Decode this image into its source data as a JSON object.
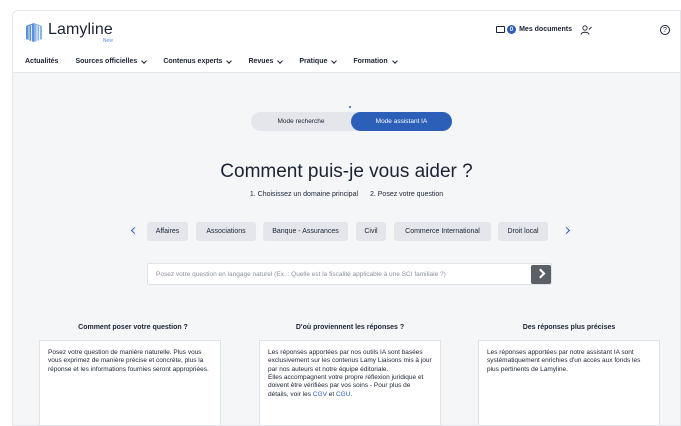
{
  "brand": {
    "name": "Lamyline",
    "sub": "New"
  },
  "header": {
    "docs_count": "0",
    "docs_label": "Mes documents",
    "help": "?"
  },
  "nav": [
    "Actualités",
    "Sources officielles",
    "Contenus experts",
    "Revues",
    "Pratique",
    "Formation"
  ],
  "mode": {
    "search": "Mode recherche",
    "assistant": "Mode assistant IA",
    "active": "assistant"
  },
  "main": {
    "title": "Comment puis-je vous aider ?",
    "step1": "1. Choisissez un domaine principal",
    "step2": "2. Posez votre question"
  },
  "domains": [
    "Affaires",
    "Associations",
    "Banque - Assurances",
    "Civil",
    "Commerce International",
    "Droit local"
  ],
  "question": {
    "placeholder": "Posez votre question en langage naturel (Ex. : Quelle est la fiscalité applicable à une SCI familiale ?)",
    "value": ""
  },
  "info": {
    "col1": {
      "title": "Comment poser votre question ?",
      "text": "Posez votre question de manière naturelle. Plus vous vous exprimez de manière précise et concrète, plus la réponse et les informations fournies seront appropriées."
    },
    "col2": {
      "title": "D'où proviennent les réponses ?",
      "text1": "Les réponses apportées par nos outils IA sont basées exclusivement sur les contenus Lamy Liaisons mis à jour par nos auteurs et notre équipe éditoriale.",
      "text2": "Elles accompagnent votre propre réflexion juridique et doivent être vérifiées par vos soins - Pour plus de détails, voir les",
      "link1": "CGV",
      "and": "et",
      "link2": "CGU",
      "end": "."
    },
    "col3": {
      "title": "Des réponses plus précises",
      "text": "Les réponses apportées par notre assistant IA sont systématiquement enrichies d'un accès aux fonds les plus pertinents de Lamyline."
    }
  },
  "colors": {
    "accent": "#2b5fb8",
    "chip_bg": "#e4e6eb",
    "page_bg": "#f5f6f8"
  },
  "icons": [
    "lamyline-logo-icon",
    "folder-icon",
    "user-add-icon",
    "help-icon",
    "chevron-left-icon",
    "chevron-right-icon",
    "send-arrow-icon"
  ]
}
